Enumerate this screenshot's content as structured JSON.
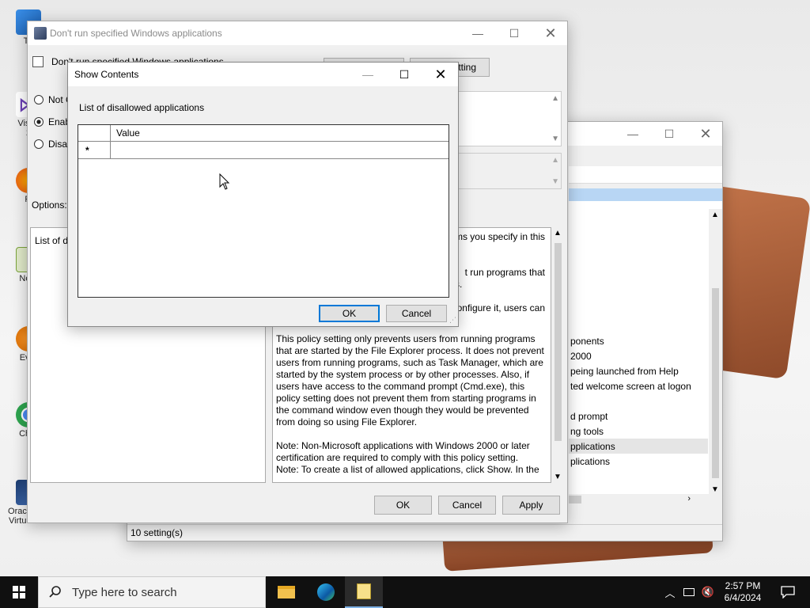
{
  "desktop": {
    "icons": [
      {
        "label": "Th",
        "icon": "this-pc-icon"
      },
      {
        "label": "Visua\n2",
        "icon": "visual-studio-icon"
      },
      {
        "label": "Fi",
        "icon": "firefox-icon"
      },
      {
        "label": "Note",
        "icon": "notepad-plus-icon"
      },
      {
        "label": "Ever",
        "icon": "everything-icon"
      },
      {
        "label": "Chro",
        "icon": "chrome-icon"
      },
      {
        "label": "Oracle VM\nVirtualBox",
        "icon": "virtualbox-icon"
      }
    ]
  },
  "gpedit_window": {
    "status_bar": "10 setting(s)",
    "right_list": [
      "ponents",
      "2000",
      "peing launched from Help",
      "ted welcome screen at logon",
      "d prompt",
      "ng tools",
      "pplications",
      "plications"
    ]
  },
  "policy_window": {
    "title": "Don't run specified Windows applications",
    "header_title": "Don't run specified Windows applications",
    "prev_button": "",
    "next_button": "tting",
    "radio_not_configured": "Not C",
    "radio_enabled": "Enab",
    "radio_disabled": "Disab",
    "options_label": "Options:",
    "options_list_label": "List of d",
    "help_fragments": [
      "ms you specify in this",
      "t run programs that",
      "s.",
      "onfigure it, users can"
    ],
    "help_para1": "This policy setting only prevents users from running programs that are started by the File Explorer process. It does not prevent users from running programs, such as Task Manager, which are started by the system process or by other processes.  Also, if users have access to the command prompt (Cmd.exe), this policy setting does not prevent them from starting programs in the command window even though they would be prevented from doing so using File Explorer.",
    "help_para2": "Note: Non-Microsoft applications with Windows 2000 or later certification are required to comply with this policy setting.",
    "help_para3": "Note: To create a list of allowed applications, click Show.  In the",
    "ok": "OK",
    "cancel": "Cancel",
    "apply": "Apply"
  },
  "show_contents": {
    "title": "Show Contents",
    "list_label": "List of disallowed applications",
    "column_value": "Value",
    "new_row_marker": "*",
    "ok": "OK",
    "cancel": "Cancel"
  },
  "taskbar": {
    "search_placeholder": "Type here to search",
    "time": "2:57 PM",
    "date": "6/4/2024"
  },
  "colors": {
    "accent": "#0078d7",
    "taskbar": "#101010",
    "selection": "#cce4f7"
  }
}
